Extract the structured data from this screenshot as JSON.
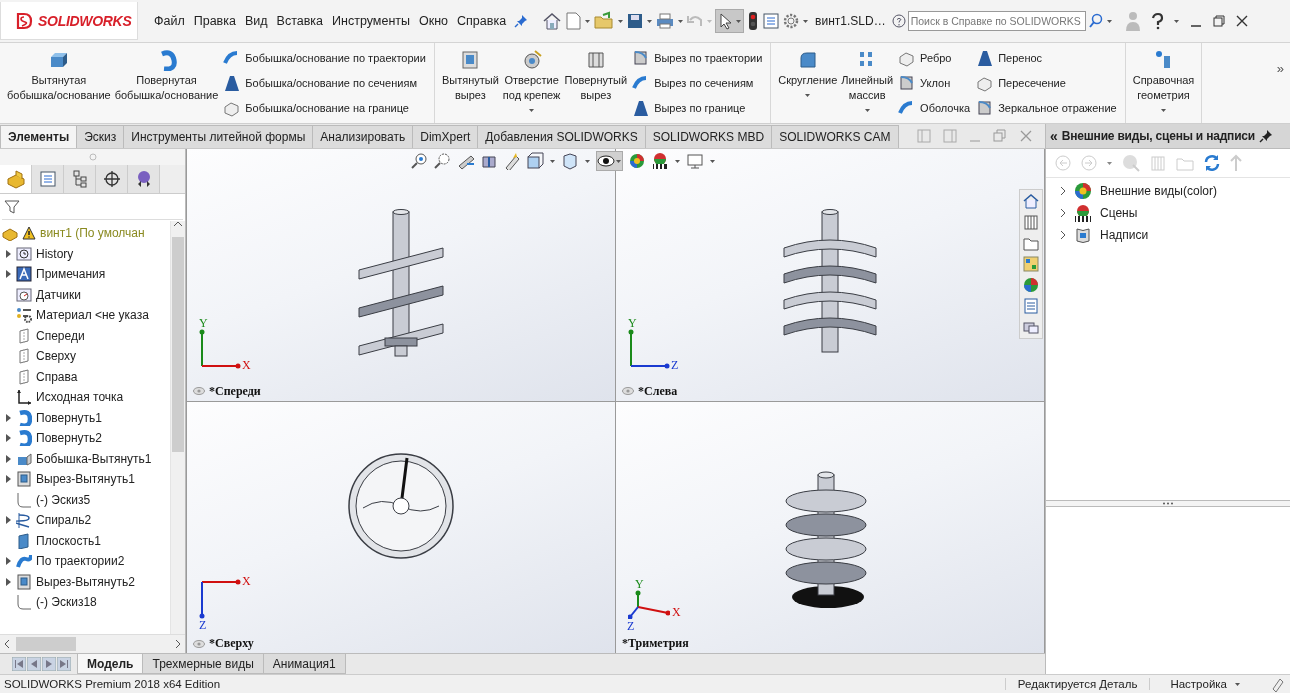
{
  "title_bar": {
    "logo": "SOLIDWORKS",
    "menu": [
      "Файл",
      "Правка",
      "Вид",
      "Вставка",
      "Инструменты",
      "Окно",
      "Справка"
    ],
    "document": "винт1.SLD…",
    "search": {
      "placeholder": "Поиск в Справке по SOLIDWORKS"
    }
  },
  "ribbon": {
    "sections": [
      {
        "columns": [
          {
            "kind": "large",
            "label": "Вытянутая\nбобышка/основание",
            "dropdown": false
          },
          {
            "kind": "large",
            "label": "Повернутая\nбобышка/основание",
            "dropdown": false
          },
          {
            "kind": "stack",
            "items": [
              "Бобышка/основание по траектории",
              "Бобышка/основание по сечениям",
              "Бобышка/основание на границе"
            ]
          }
        ]
      },
      {
        "columns": [
          {
            "kind": "large",
            "label": "Вытянутый\nвырез",
            "dropdown": false
          },
          {
            "kind": "large",
            "label": "Отверстие\nпод крепеж",
            "dropdown": true
          },
          {
            "kind": "large",
            "label": "Повернутый\nвырез",
            "dropdown": false
          },
          {
            "kind": "stack",
            "items": [
              "Вырез по траектории",
              "Вырез по сечениям",
              "Вырез по границе"
            ]
          }
        ]
      },
      {
        "columns": [
          {
            "kind": "large",
            "label": "Скругление",
            "dropdown": true
          },
          {
            "kind": "large",
            "label": "Линейный\nмассив",
            "dropdown": true
          },
          {
            "kind": "stack",
            "items": [
              "Ребро",
              "Уклон",
              "Оболочка"
            ]
          },
          {
            "kind": "stack",
            "items": [
              "Перенос",
              "Пересечение",
              "Зеркальное отражение"
            ]
          }
        ]
      },
      {
        "columns": [
          {
            "kind": "large",
            "label": "Справочная\nгеометрия",
            "dropdown": true
          }
        ]
      }
    ],
    "overflow": "»"
  },
  "tabs": [
    {
      "label": "Элементы",
      "selected": true
    },
    {
      "label": "Эскиз",
      "selected": false
    },
    {
      "label": "Инструменты литейной формы",
      "selected": false
    },
    {
      "label": "Анализировать",
      "selected": false
    },
    {
      "label": "DimXpert",
      "selected": false
    },
    {
      "label": "Добавления SOLIDWORKS",
      "selected": false
    },
    {
      "label": "SOLIDWORKS MBD",
      "selected": false
    },
    {
      "label": "SOLIDWORKS CAM",
      "selected": false
    }
  ],
  "feature_tree": {
    "root": {
      "label": "винт1  (По умолчан",
      "children": [
        {
          "label": "History",
          "kind": "history",
          "expandable": true
        },
        {
          "label": "Примечания",
          "kind": "annotations",
          "expandable": true
        },
        {
          "label": "Датчики",
          "kind": "sensors",
          "expandable": false
        },
        {
          "label": "Материал <не указа",
          "kind": "material",
          "expandable": false
        },
        {
          "label": "Спереди",
          "kind": "plane",
          "expandable": false
        },
        {
          "label": "Сверху",
          "kind": "plane",
          "expandable": false
        },
        {
          "label": "Справа",
          "kind": "plane",
          "expandable": false
        },
        {
          "label": "Исходная точка",
          "kind": "origin",
          "expandable": false
        },
        {
          "label": "Повернуть1",
          "kind": "revolve",
          "expandable": true
        },
        {
          "label": "Повернуть2",
          "kind": "revolve",
          "expandable": true
        },
        {
          "label": "Бобышка-Вытянуть1",
          "kind": "extrude",
          "expandable": true
        },
        {
          "label": "Вырез-Вытянуть1",
          "kind": "cut",
          "expandable": true
        },
        {
          "label": "(-) Эскиз5",
          "kind": "sketch",
          "expandable": false
        },
        {
          "label": "Спираль2",
          "kind": "helix",
          "expandable": true
        },
        {
          "label": "Плоскость1",
          "kind": "refplane",
          "expandable": false
        },
        {
          "label": "По траектории2",
          "kind": "sweep",
          "expandable": true
        },
        {
          "label": "Вырез-Вытянуть2",
          "kind": "cut",
          "expandable": true
        },
        {
          "label": "(-) Эскиз18",
          "kind": "sketch",
          "expandable": false
        }
      ]
    }
  },
  "viewport": {
    "views": [
      {
        "kind": "front",
        "label": "*Спереди",
        "axes": [
          {
            "label": "Y",
            "color": "#1a8a1a"
          },
          {
            "label": "X",
            "color": "#d01010"
          }
        ]
      },
      {
        "kind": "left",
        "label": "*Слева",
        "axes": [
          {
            "label": "Y",
            "color": "#1a8a1a"
          },
          {
            "label": "Z",
            "color": "#1a3ad0"
          }
        ]
      },
      {
        "kind": "top",
        "label": "*Сверху",
        "axes": [
          {
            "label": "X",
            "color": "#d01010"
          },
          {
            "label": "Z",
            "color": "#1a3ad0"
          }
        ]
      },
      {
        "kind": "trimetric",
        "label": "*Триметрия",
        "axes": [
          {
            "label": "Y",
            "color": "#1a8a1a"
          },
          {
            "label": "X",
            "color": "#d01010"
          },
          {
            "label": "Z",
            "color": "#1a3ad0"
          }
        ]
      }
    ]
  },
  "task_panel": {
    "collapse": "«",
    "title": "Внешние виды, сцены и надписи",
    "items": [
      {
        "label": "Внешние виды(color)",
        "kind": "appearance",
        "expanded": false
      },
      {
        "label": "Сцены",
        "kind": "scene",
        "expanded": false
      },
      {
        "label": "Надписи",
        "kind": "decal",
        "expanded": false
      }
    ]
  },
  "bottom_tabs": [
    {
      "label": "Модель",
      "selected": true
    },
    {
      "label": "Трехмерные виды",
      "selected": false
    },
    {
      "label": "Анимация1",
      "selected": false
    }
  ],
  "status_bar": {
    "edition": "SOLIDWORKS Premium 2018 x64 Edition",
    "mode": "Редактируется Деталь",
    "settings": "Настройка"
  }
}
